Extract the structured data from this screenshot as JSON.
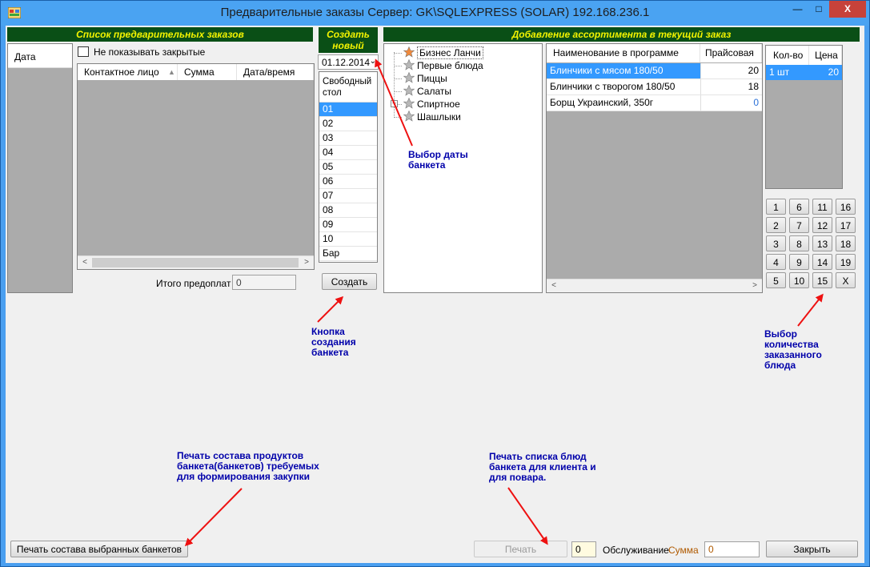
{
  "window": {
    "title": "Предварительные заказы  Сервер: GK\\SQLEXPRESS (SOLAR) 192.168.236.1",
    "minimize": "—",
    "maximize": "□",
    "close": "X"
  },
  "left_panel": {
    "header": "Список предварительных заказов",
    "date_column": "Дата",
    "hide_closed_label": "Не показывать закрытые",
    "columns": [
      "Контактное лицо",
      "Сумма",
      "Дата/время"
    ],
    "total_label": "Итого предоплат",
    "total_value": "0"
  },
  "create_panel": {
    "header_line1": "Создать",
    "header_line2": "новый",
    "date_value": "01.12.2014",
    "free_table_header_line1": "Свободный",
    "free_table_header_line2": "стол",
    "tables": [
      "01",
      "02",
      "03",
      "04",
      "05",
      "06",
      "07",
      "08",
      "09",
      "10",
      "Бар"
    ],
    "selected_table": "01",
    "create_button": "Создать"
  },
  "assortment_panel": {
    "header": "Добавление ассортимента в текущий заказ",
    "tree": [
      "Бизнес Ланчи",
      "Первые блюда",
      "Пиццы",
      "Салаты",
      "Спиртное",
      "Шашлыки"
    ],
    "grid_columns": [
      "Наименование в программе",
      "Прайсовая"
    ],
    "grid_rows": [
      {
        "name": "Блинчики с мясом 180/50",
        "price": "20"
      },
      {
        "name": "Блинчики с творогом 180/50",
        "price": "18"
      },
      {
        "name": "Борщ Украинский, 350г",
        "price": "0"
      }
    ]
  },
  "quantity_panel": {
    "columns": [
      "Кол-во",
      "Цена"
    ],
    "rows": [
      {
        "qty": "1 шт",
        "price": "20"
      }
    ],
    "numpad": [
      [
        "1",
        "6",
        "11",
        "16"
      ],
      [
        "2",
        "7",
        "12",
        "17"
      ],
      [
        "3",
        "8",
        "13",
        "18"
      ],
      [
        "4",
        "9",
        "14",
        "19"
      ],
      [
        "5",
        "10",
        "15",
        "X"
      ]
    ]
  },
  "annotations": {
    "date_choice": [
      "Выбор даты",
      "банкета"
    ],
    "create_button": [
      "Кнопка",
      "создания",
      "банкета"
    ],
    "quantity_choice": [
      "Выбор",
      "количества",
      "заказанного",
      "блюда"
    ],
    "print_products": [
      "Печать состава продуктов",
      "банкета(банкетов) требуемых",
      "для формирования закупки"
    ],
    "print_list": [
      "Печать списка блюд",
      "банкета для клиента и",
      "для повара."
    ]
  },
  "bottom_bar": {
    "print_selected_button": "Печать состава выбранных банкетов",
    "print_button": "Печать",
    "count_value": "0",
    "service_label": "Обслуживание",
    "sum_label": "Сумма",
    "sum_value": "0",
    "close_button": "Закрыть"
  },
  "colors": {
    "green_header": "#0a4f16",
    "header_text": "#f3f300",
    "selection": "#3399ff",
    "annotation": "#0000aa",
    "arrow": "#ee1111"
  }
}
